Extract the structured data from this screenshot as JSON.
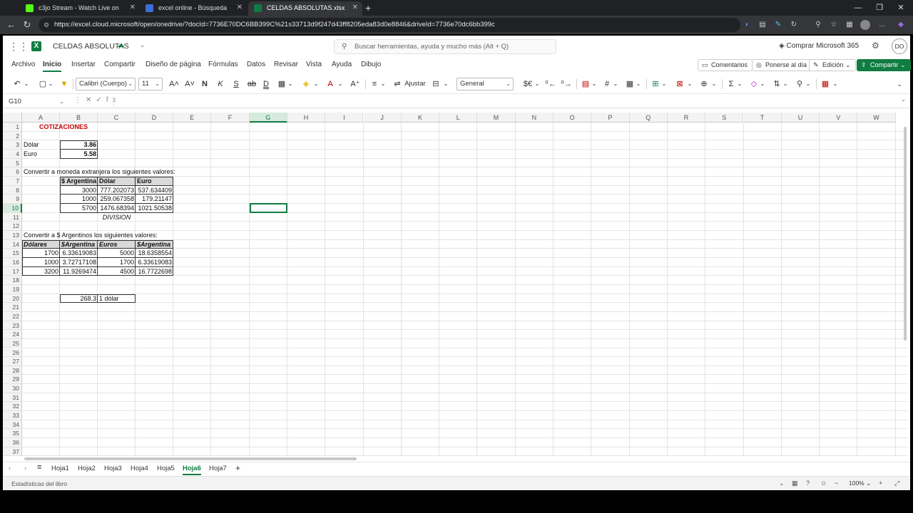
{
  "browser": {
    "tabs": [
      {
        "title": "c3jo Stream - Watch Live on",
        "icon_color": "#53fc18"
      },
      {
        "title": "excel online - Búsqueda",
        "icon_color": "#3c6fd8"
      },
      {
        "title": "CELDAS ABSOLUTAS.xlsx",
        "icon_color": "#107c41"
      }
    ],
    "new_tab": "+",
    "url": "https://excel.cloud.microsoft/open/onedrive/?docId=7736E70DC6BB399C%21s33713d9f247d43ff8205eda83d0e8846&driveId=7736e70dc6bb399c"
  },
  "app": {
    "doc_name": "CELDAS ABSOLUTAS",
    "search_placeholder": "Buscar herramientas, ayuda y mucho más (Alt + Q)",
    "buy": "Comprar Microsoft 365",
    "avatar": "DO",
    "accent": "#107c41"
  },
  "menus": [
    "Archivo",
    "Inicio",
    "Insertar",
    "Compartir",
    "Diseño de página",
    "Fórmulas",
    "Datos",
    "Revisar",
    "Vista",
    "Ayuda",
    "Dibujo"
  ],
  "menu_active": 1,
  "ribbon_buttons": {
    "comments": "Comentarios",
    "catchup": "Ponerse al día",
    "edit": "Edición",
    "share": "Compartir"
  },
  "toolbar": {
    "font": "Calibri (Cuerpo)",
    "size": "11",
    "wrap": "Ajustar",
    "number_format": "General"
  },
  "formula_bar": {
    "name_box": "G10",
    "fx": "fx"
  },
  "columns": [
    "A",
    "B",
    "C",
    "D",
    "E",
    "F",
    "G",
    "H",
    "I",
    "J",
    "K",
    "L",
    "M",
    "N",
    "O",
    "P",
    "Q",
    "R",
    "S",
    "T",
    "U",
    "V",
    "W"
  ],
  "selected_col": "G",
  "selected_row": 10,
  "rows": 37,
  "cells": {
    "title": "COTIZACIONES",
    "dolar_label": "Dólar",
    "dolar_val": "3.86",
    "euro_label": "Euro",
    "euro_val": "5.58",
    "convert1": "Convertir a moneda extranjera los siguientes valores:",
    "t1_h1": "$ Argentina",
    "t1_h2": "Dólar",
    "t1_h3": "Euro",
    "t1_rows": [
      [
        "3000",
        "777.202073",
        "537.634409"
      ],
      [
        "1000",
        "259.067358",
        "179.21147"
      ],
      [
        "5700",
        "1476.68394",
        "1021.50538"
      ]
    ],
    "division": "DIVISION",
    "convert2": "Convertir a $ Argentinos los siguientes valores:",
    "t2_h1": "Dólares",
    "t2_h2": "$Argentina",
    "t2_h3": "Euros",
    "t2_h4": "$Argentina",
    "t2_rows": [
      [
        "1700",
        "6.33619083",
        "5000",
        "18.6358554"
      ],
      [
        "1000",
        "3.72717108",
        "1700",
        "6.33619083"
      ],
      [
        "3200",
        "11.9269474",
        "4500",
        "16.7722698"
      ]
    ],
    "r20_val": "268.3",
    "r20_label": "1 dólar"
  },
  "sheets": [
    "Hoja1",
    "Hoja2",
    "Hoja3",
    "Hoja4",
    "Hoja5",
    "Hoja6",
    "Hoja7"
  ],
  "sheet_active": 5,
  "status": {
    "text": "Estadísticas del libro",
    "zoom": "100%"
  }
}
